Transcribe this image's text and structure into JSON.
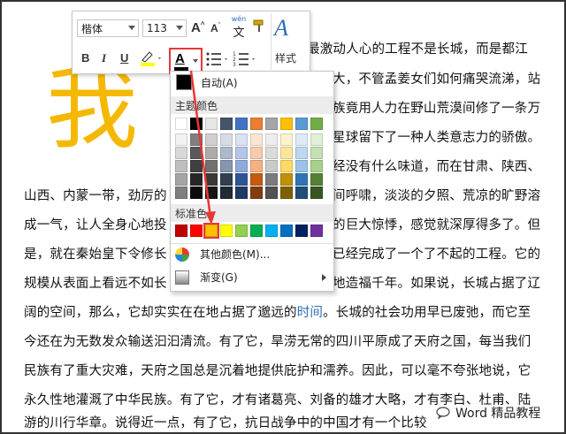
{
  "document": {
    "lines": [
      "最激动人心的工程不是长城，而是都江",
      "大，不管孟姜女们如何痛哭流涕，站",
      "族竟用人力在野山荒漠间修了一条万",
      "星球留下了一种人类意志力的骄傲。",
      "经没有什么味道，而在甘肃、陕西、",
      "山西、内蒙一带，劲厉的",
      "间呼啸，淡淡的夕照、荒凉的旷野溶",
      "成一气，让人全身心地投",
      "的巨大惊悸，感觉就深厚得多了。但",
      "是，就在秦始皇下令修长",
      "已经完成了一个了不起的工程。它的",
      "规模从表面上看远不如长",
      "地造福千年。如果说，长城占据了辽",
      "阔的空间，那么，它却实实在在地占据了邈远的",
      "时间",
      "。长城的社会功用早已废弛，而它至",
      "今还在为无数发众输送汩汩清流。有了它，旱涝无常的四川平原成了天府之国，每当我们",
      "民族有了重大灾难，天府之国总是沉着地提供庇护和濡养。因此，可以毫不夸张地说，它",
      "永久性地灌溉了中华民族。有了它，才有诸葛亮、刘备的雄才大略，才有李白、杜甫、陆",
      "游的川行华章。说得近一点，有了它，抗日战争中的中国才有一个比较"
    ],
    "big_char": "我",
    "watermark": "Word 精品教程"
  },
  "toolbar": {
    "font_name": "楷体",
    "font_size": "113",
    "grow_font": "A",
    "shrink_font": "A",
    "phonetic_top": "wén",
    "phonetic_bottom": "文",
    "bold": "B",
    "italic": "I",
    "underline": "U",
    "font_color_glyph": "A",
    "styles_label": "样式",
    "styles_glyph": "A"
  },
  "color_menu": {
    "automatic_label": "自动(A)",
    "theme_colors_label": "主题颜色",
    "standard_colors_label": "标准色",
    "more_colors_label": "其他颜色(M)...",
    "gradient_label": "渐变(G)",
    "theme_colors": [
      [
        "#ffffff",
        "#000000",
        "#e7e6e6",
        "#44546a",
        "#4472c4",
        "#ed7d31",
        "#a5a5a5",
        "#ffc000",
        "#5b9bd5",
        "#70ad47"
      ],
      [
        "#f2f2f2",
        "#808080",
        "#d0cece",
        "#d6dce4",
        "#d9e2f3",
        "#fbe5d5",
        "#ededed",
        "#fff2cc",
        "#deebf6",
        "#e2efd9"
      ],
      [
        "#d8d8d8",
        "#595959",
        "#aeabab",
        "#adb9ca",
        "#b4c6e7",
        "#f7cbac",
        "#dbdbdb",
        "#fee599",
        "#bdd7ee",
        "#c5e0b3"
      ],
      [
        "#bfbfbf",
        "#3f3f3f",
        "#757070",
        "#8496b0",
        "#8eaadb",
        "#f4b183",
        "#c9c9c9",
        "#ffd965",
        "#9cc3e5",
        "#a8d08d"
      ],
      [
        "#a5a5a5",
        "#262626",
        "#3a3838",
        "#323f4f",
        "#2f5496",
        "#c55a11",
        "#7b7b7b",
        "#bf9000",
        "#2e75b5",
        "#538135"
      ],
      [
        "#7f7f7f",
        "#0c0c0c",
        "#171616",
        "#222a35",
        "#1f3864",
        "#833c0b",
        "#525252",
        "#7f6000",
        "#1e4e79",
        "#375623"
      ]
    ],
    "standard_colors": [
      "#c00000",
      "#ff0000",
      "#ffc000",
      "#ffff00",
      "#92d050",
      "#00b050",
      "#00b0f0",
      "#0070c0",
      "#002060",
      "#7030a0"
    ],
    "selected_standard_index": 2
  }
}
